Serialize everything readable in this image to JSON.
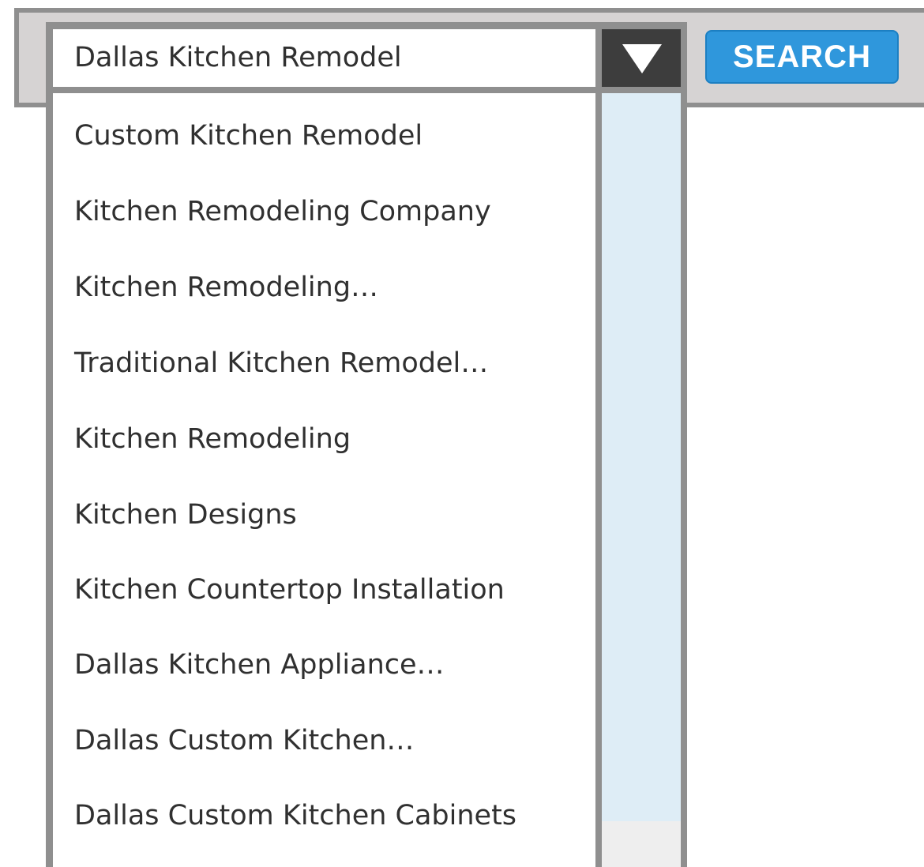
{
  "search_box": {
    "selected_value": "Dallas Kitchen Remodel"
  },
  "dropdown_button": {
    "icon": "triangle-down-icon"
  },
  "dropdown_options": [
    "Custom Kitchen Remodel",
    "Kitchen Remodeling Company",
    "Kitchen Remodeling…",
    "Traditional Kitchen Remodel…",
    "Kitchen Remodeling",
    "Kitchen Designs",
    "Kitchen Countertop Installation",
    "Dallas Kitchen Appliance…",
    "Dallas Custom Kitchen…",
    "Dallas Custom Kitchen Cabinets"
  ],
  "search_button": {
    "label": "SEARCH"
  },
  "colors": {
    "search_button_bg": "#2f97dc",
    "frame_gray": "#8f8f8f",
    "bar_bg": "#d6d3d3",
    "dropdown_button_bg": "#3d3d3d",
    "scrollbar_thumb": "#deedf6"
  }
}
